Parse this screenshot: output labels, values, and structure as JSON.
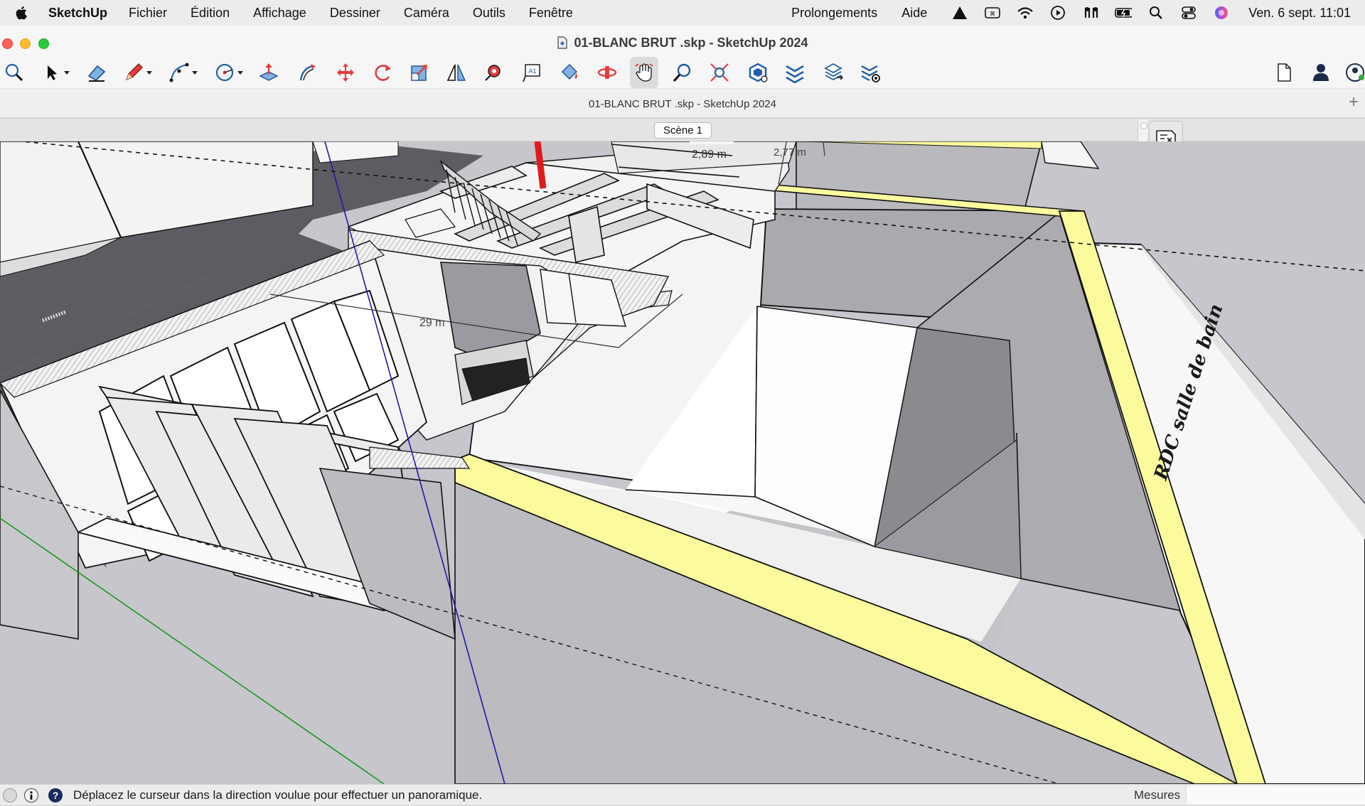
{
  "menubar": {
    "app_name": "SketchUp",
    "items": [
      "Fichier",
      "Édition",
      "Affichage",
      "Dessiner",
      "Caméra",
      "Outils",
      "Fenêtre"
    ],
    "right_items": [
      "Prolongements",
      "Aide"
    ],
    "clock": "Ven. 6 sept.  11:01",
    "status_icons": [
      "adobe-icon",
      "keyboard-viewer-icon",
      "wifi-icon",
      "play-icon",
      "airpods-icon",
      "battery-icon",
      "spotlight-icon",
      "control-center-icon",
      "siri-icon"
    ]
  },
  "window": {
    "title": "01-BLANC BRUT .skp - SketchUp 2024",
    "tab_title": "01-BLANC BRUT .skp - SketchUp 2024"
  },
  "toolbar": {
    "tools": [
      {
        "name": "search-tool",
        "icon": "magnifier-icon"
      },
      {
        "name": "select-tool",
        "icon": "arrow-icon"
      },
      {
        "name": "eraser-tool",
        "icon": "eraser-icon"
      },
      {
        "name": "pencil-tool",
        "icon": "pencil-icon"
      },
      {
        "name": "arc-tool",
        "icon": "arc-icon"
      },
      {
        "name": "circle-tool",
        "icon": "circle-icon"
      },
      {
        "name": "push-pull-tool",
        "icon": "push-pull-icon"
      },
      {
        "name": "follow-me-tool",
        "icon": "follow-me-icon"
      },
      {
        "name": "move-tool",
        "icon": "move-icon"
      },
      {
        "name": "rotate-tool",
        "icon": "rotate-icon"
      },
      {
        "name": "scale-tool",
        "icon": "scale-icon"
      },
      {
        "name": "flip-tool",
        "icon": "flip-icon"
      },
      {
        "name": "tape-measure-tool",
        "icon": "tape-icon"
      },
      {
        "name": "text-tool",
        "icon": "text-icon"
      },
      {
        "name": "paint-bucket-tool",
        "icon": "paint-bucket-icon"
      },
      {
        "name": "orbit-tool",
        "icon": "orbit-icon"
      },
      {
        "name": "pan-tool",
        "icon": "hand-icon"
      },
      {
        "name": "zoom-tool",
        "icon": "zoom-icon"
      },
      {
        "name": "zoom-extents-tool",
        "icon": "zoom-extents-icon"
      },
      {
        "name": "components-tool",
        "icon": "components-icon"
      },
      {
        "name": "tags-tool",
        "icon": "tags-icon"
      },
      {
        "name": "layers-tool",
        "icon": "layers-icon"
      },
      {
        "name": "layer-settings-tool",
        "icon": "layer-settings-icon"
      }
    ],
    "active_tool": "pan-tool",
    "right_tools": [
      "new-document-icon",
      "user-icon",
      "account-icon"
    ]
  },
  "scenes": {
    "active": "Scène 1"
  },
  "viewport": {
    "dimension_labels": [
      "2,89 m",
      "2,77 m",
      "29 m"
    ],
    "floor_text": "RDC salle de bain"
  },
  "status": {
    "message": "Déplacez le curseur dans la direction voulue pour effectuer un panoramique.",
    "measures_label": "Mesures",
    "measures_value": ""
  },
  "colors": {
    "menubar_bg": "#ececec",
    "toolbar_bg": "#f6f6f6",
    "highlight_yellow": "#fbfb9e",
    "axis_red": "#e01b1b",
    "axis_blue": "#1c1ca8",
    "axis_green": "#1a9a1a",
    "shadow": "#5a5a60",
    "ground": "#c6c6cc"
  }
}
